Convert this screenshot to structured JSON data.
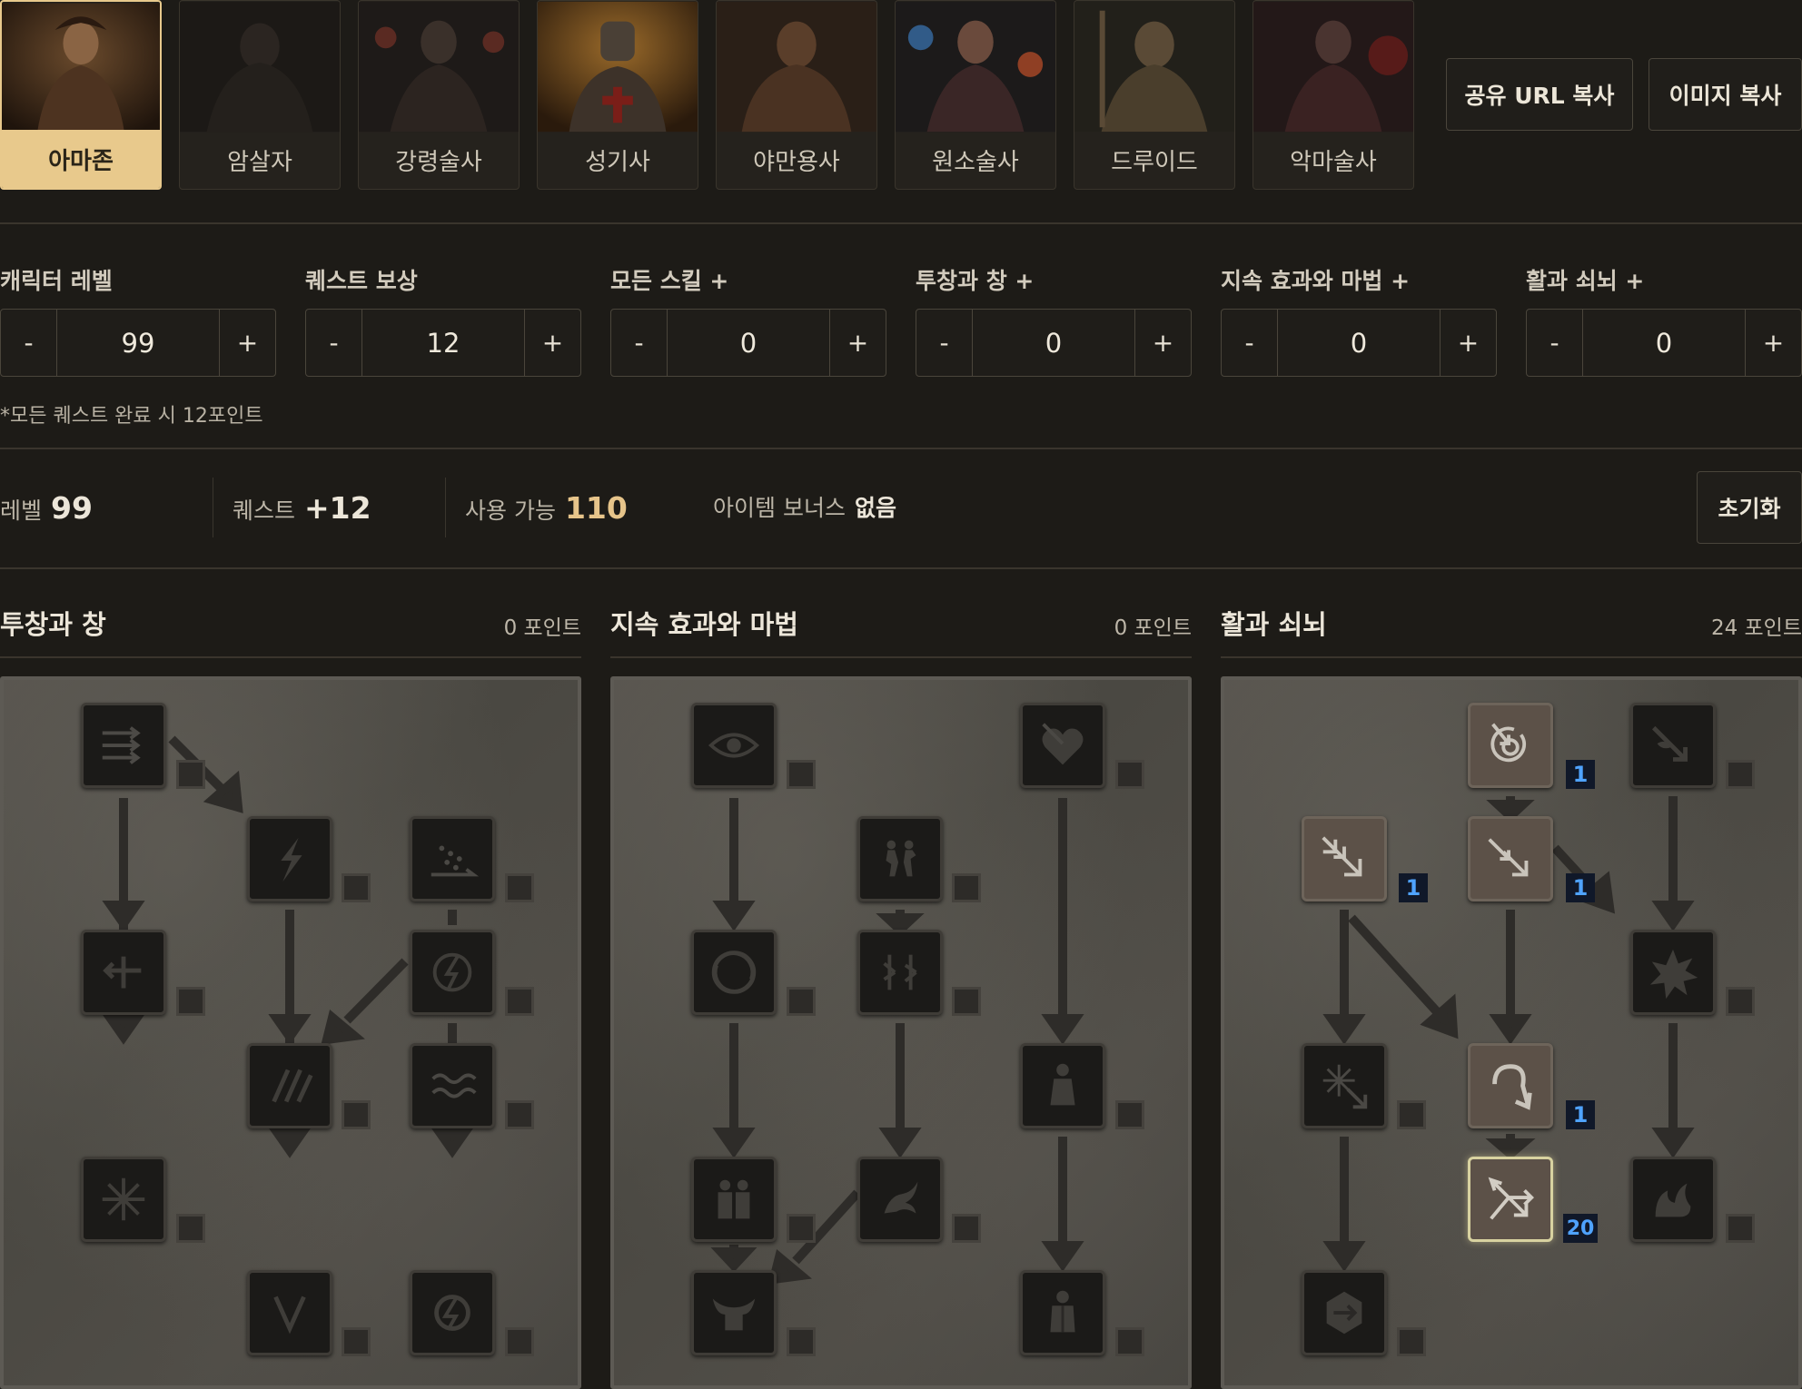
{
  "classes": [
    {
      "label": "아마존",
      "active": true
    },
    {
      "label": "암살자",
      "active": false
    },
    {
      "label": "강령술사",
      "active": false
    },
    {
      "label": "성기사",
      "active": false
    },
    {
      "label": "야만용사",
      "active": false
    },
    {
      "label": "원소술사",
      "active": false
    },
    {
      "label": "드루이드",
      "active": false
    },
    {
      "label": "악마술사",
      "active": false
    }
  ],
  "actions": {
    "share_url": "공유 URL 복사",
    "copy_image": "이미지 복사",
    "reset": "초기화"
  },
  "controls": [
    {
      "label": "캐릭터 레벨",
      "value": "99"
    },
    {
      "label": "퀘스트 보상",
      "value": "12"
    },
    {
      "label": "모든 스킬 +",
      "value": "0"
    },
    {
      "label": "투창과 창 +",
      "value": "0"
    },
    {
      "label": "지속 효과와 마법 +",
      "value": "0"
    },
    {
      "label": "활과 쇠뇌 +",
      "value": "0"
    }
  ],
  "stepper": {
    "minus": "-",
    "plus": "+"
  },
  "note": "*모든 퀘스트 완료 시 12포인트",
  "summary": {
    "level_label": "레벨",
    "level_value": "99",
    "quest_label": "퀘스트",
    "quest_value": "+12",
    "available_label": "사용 가능",
    "available_value": "110",
    "item_label": "아이템 보너스",
    "item_value": "없음"
  },
  "trees": [
    {
      "title": "투창과 창",
      "points": "0 포인트"
    },
    {
      "title": "지속 효과와 마법",
      "points": "0 포인트"
    },
    {
      "title": "활과 쇠뇌",
      "points": "24 포인트"
    }
  ],
  "bow_points": {
    "magic_arrow": "1",
    "cold_arrow": "1",
    "multiple_shot": "1",
    "guided_arrow": "1",
    "strafe": "20"
  },
  "colors": {
    "accent": "#e8c98c",
    "points_blue": "#4fa3ff"
  }
}
